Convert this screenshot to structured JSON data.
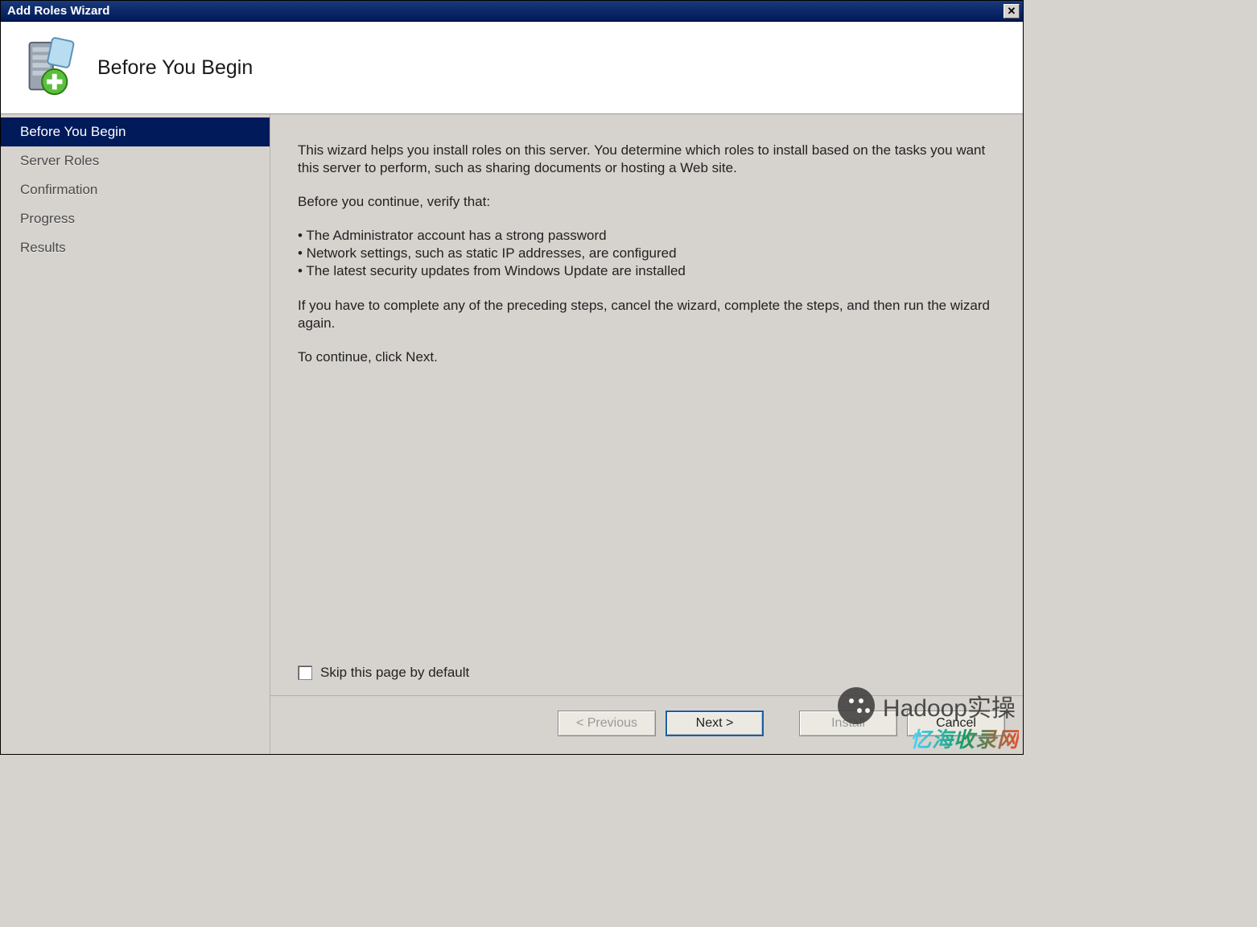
{
  "titlebar": {
    "title": "Add Roles Wizard"
  },
  "header": {
    "title": "Before You Begin"
  },
  "sidebar": {
    "items": [
      {
        "label": "Before You Begin",
        "selected": true
      },
      {
        "label": "Server Roles",
        "selected": false
      },
      {
        "label": "Confirmation",
        "selected": false
      },
      {
        "label": "Progress",
        "selected": false
      },
      {
        "label": "Results",
        "selected": false
      }
    ]
  },
  "content": {
    "intro": "This wizard helps you install roles on this server. You determine which roles to install based on the tasks you want this server to perform, such as sharing documents or hosting a Web site.",
    "verify_heading": "Before you continue, verify that:",
    "bullets": [
      "The Administrator account has a strong password",
      "Network settings, such as static IP addresses, are configured",
      "The latest security updates from Windows Update are installed"
    ],
    "cancel_note": "If you have to complete any of the preceding steps, cancel the wizard, complete the steps, and then run the wizard again.",
    "continue_note": "To continue, click Next.",
    "skip_label": "Skip this page by default",
    "skip_checked": false
  },
  "footer": {
    "previous": "< Previous",
    "next": "Next >",
    "install": "Install",
    "cancel": "Cancel"
  },
  "watermarks": {
    "brand1": "Hadoop实操",
    "brand2": "忆海收录网"
  }
}
